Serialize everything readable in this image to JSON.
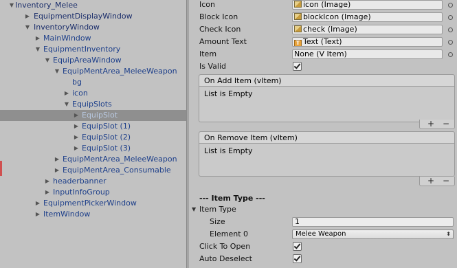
{
  "hierarchy": {
    "items": [
      {
        "label": "Inventory_Melee",
        "arrow": "▼"
      },
      {
        "label": "EquipmentDisplayWindow",
        "arrow": "▶"
      },
      {
        "label": "InventoryWindow",
        "arrow": "▼"
      },
      {
        "label": "MainWindow",
        "arrow": "▶"
      },
      {
        "label": "EquipmentInventory",
        "arrow": "▼"
      },
      {
        "label": "EquipAreaWindow",
        "arrow": "▼"
      },
      {
        "label": "EquipMentArea_MeleeWeapon",
        "arrow": "▼"
      },
      {
        "label": "bg",
        "arrow": ""
      },
      {
        "label": "icon",
        "arrow": "▶"
      },
      {
        "label": "EquipSlots",
        "arrow": "▼"
      },
      {
        "label": "EquipSlot",
        "arrow": "▶"
      },
      {
        "label": "EquipSlot (1)",
        "arrow": "▶"
      },
      {
        "label": "EquipSlot (2)",
        "arrow": "▶"
      },
      {
        "label": "EquipSlot (3)",
        "arrow": "▶"
      },
      {
        "label": "EquipMentArea_MeleeWeapon",
        "arrow": "▶"
      },
      {
        "label": "EquipMentArea_Consumable",
        "arrow": "▶"
      },
      {
        "label": "headerbanner",
        "arrow": "▶"
      },
      {
        "label": "InputInfoGroup",
        "arrow": "▶"
      },
      {
        "label": "EquipmentPickerWindow",
        "arrow": "▶"
      },
      {
        "label": "ItemWindow",
        "arrow": "▶"
      }
    ]
  },
  "inspector": {
    "icon": {
      "label": "Icon",
      "value": "icon (Image)"
    },
    "block_icon": {
      "label": "Block Icon",
      "value": "blockIcon (Image)"
    },
    "check_icon": {
      "label": "Check Icon",
      "value": "check (Image)"
    },
    "amount_text": {
      "label": "Amount Text",
      "value": "Text (Text)"
    },
    "item": {
      "label": "Item",
      "value": "None (V Item)"
    },
    "is_valid": {
      "label": "Is Valid",
      "checked": true
    },
    "on_add_item": {
      "header": "On Add Item (vItem)",
      "body": "List is Empty",
      "plus": "+",
      "minus": "−"
    },
    "on_remove_item": {
      "header": "On Remove Item (vItem)",
      "body": "List is Empty",
      "plus": "+",
      "minus": "−"
    },
    "section_title": "--- Item Type ---",
    "item_type": {
      "label": "Item Type",
      "arrow": "▼"
    },
    "size": {
      "label": "Size",
      "value": "1"
    },
    "element0": {
      "label": "Element 0",
      "value": "Melee Weapon",
      "caret": "⬍"
    },
    "click_to_open": {
      "label": "Click To Open",
      "checked": true
    },
    "auto_deselect": {
      "label": "Auto Deselect",
      "checked": true
    }
  }
}
